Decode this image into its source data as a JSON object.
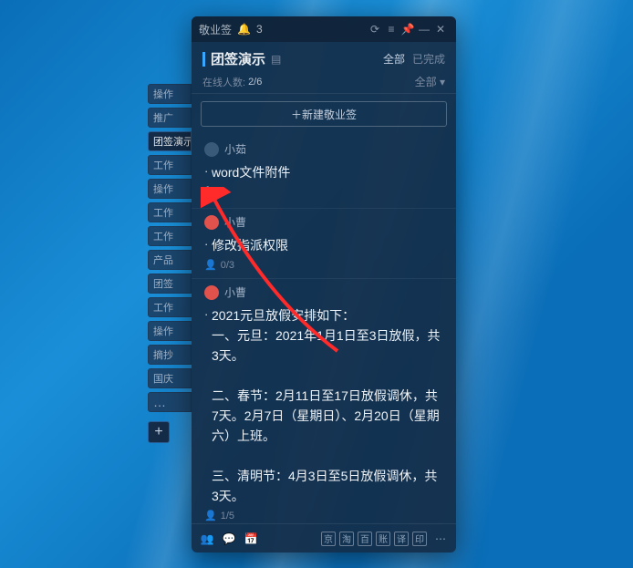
{
  "titlebar": {
    "app_name": "敬业签",
    "notif_count": "3"
  },
  "header": {
    "title": "团签演示",
    "tab_all": "全部",
    "tab_done": "已完成",
    "online_label": "在线人数:",
    "online_value": "2/6",
    "filter": "全部 ▾"
  },
  "new_btn": "＋新建敬业签",
  "items": [
    {
      "owner": "小茹",
      "avatar_class": "avatar",
      "text": "word文件附件",
      "has_attachment": true,
      "meta": ""
    },
    {
      "owner": "小曹",
      "avatar_class": "avatar red",
      "text": "修改指派权限",
      "has_attachment": false,
      "meta_icon": "👤",
      "meta": "0/3"
    },
    {
      "owner": "小曹",
      "avatar_class": "avatar red",
      "text": "2021元旦放假安排如下：\n一、元旦：2021年1月1日至3日放假，共3天。\n\n二、春节：2月11日至17日放假调休，共7天。2月7日（星期日）、2月20日（星期六）上班。\n\n三、清明节：4月3日至5日放假调休，共3天。",
      "has_attachment": false,
      "meta_icon": "👤",
      "meta": "1/5"
    }
  ],
  "side_tabs": [
    "操作",
    "推广",
    "团签演示",
    "工作",
    "操作",
    "工作",
    "工作",
    "产品",
    "团签",
    "工作",
    "操作",
    "摘抄",
    "国庆",
    "…"
  ],
  "footer_squares": [
    "京",
    "淘",
    "百",
    "账",
    "译",
    "印"
  ]
}
